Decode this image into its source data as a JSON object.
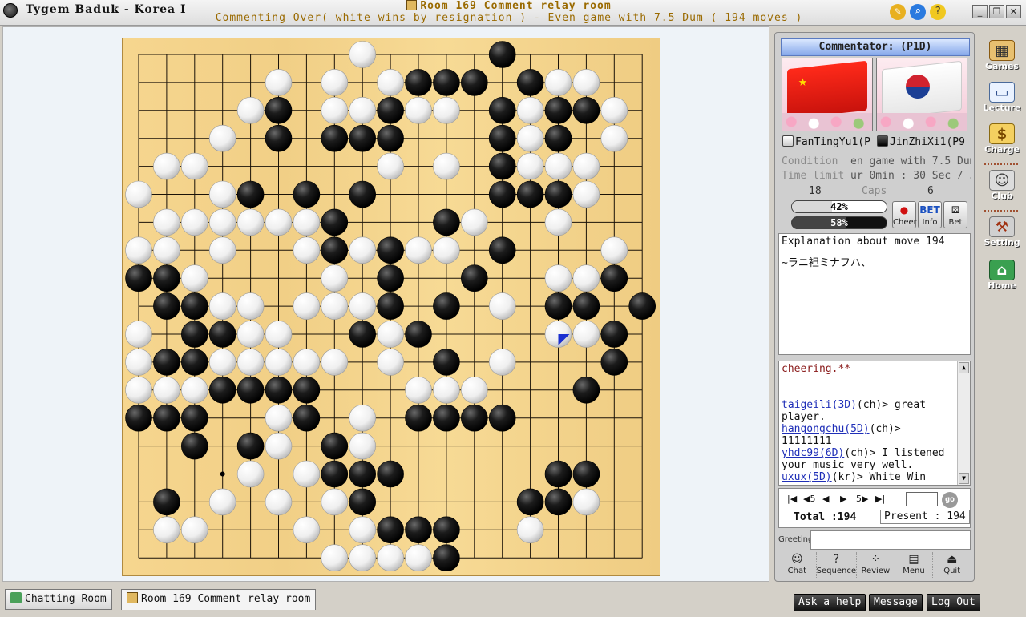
{
  "window": {
    "app_title": "Tygem Baduk - Korea I",
    "room_title": "Room 169 Comment relay room",
    "room_subtitle": "Commenting Over( white wins by resignation ) - Even game with 7.5 Dum  ( 194 moves )"
  },
  "board": {
    "size": 19,
    "black": [
      [
        13,
        0
      ],
      [
        10,
        1
      ],
      [
        11,
        1
      ],
      [
        12,
        1
      ],
      [
        14,
        1
      ],
      [
        5,
        2
      ],
      [
        9,
        2
      ],
      [
        13,
        2
      ],
      [
        15,
        2
      ],
      [
        16,
        2
      ],
      [
        5,
        3
      ],
      [
        7,
        3
      ],
      [
        8,
        3
      ],
      [
        9,
        3
      ],
      [
        13,
        3
      ],
      [
        15,
        3
      ],
      [
        13,
        4
      ],
      [
        4,
        5
      ],
      [
        6,
        5
      ],
      [
        8,
        5
      ],
      [
        13,
        5
      ],
      [
        14,
        5
      ],
      [
        15,
        5
      ],
      [
        7,
        6
      ],
      [
        11,
        6
      ],
      [
        7,
        7
      ],
      [
        9,
        7
      ],
      [
        13,
        7
      ],
      [
        0,
        8
      ],
      [
        1,
        8
      ],
      [
        9,
        8
      ],
      [
        12,
        8
      ],
      [
        17,
        8
      ],
      [
        1,
        9
      ],
      [
        2,
        9
      ],
      [
        9,
        9
      ],
      [
        11,
        9
      ],
      [
        15,
        9
      ],
      [
        16,
        9
      ],
      [
        18,
        9
      ],
      [
        2,
        10
      ],
      [
        3,
        10
      ],
      [
        8,
        10
      ],
      [
        10,
        10
      ],
      [
        17,
        10
      ],
      [
        1,
        11
      ],
      [
        2,
        11
      ],
      [
        11,
        11
      ],
      [
        17,
        11
      ],
      [
        3,
        12
      ],
      [
        4,
        12
      ],
      [
        5,
        12
      ],
      [
        6,
        12
      ],
      [
        16,
        12
      ],
      [
        0,
        13
      ],
      [
        1,
        13
      ],
      [
        2,
        13
      ],
      [
        6,
        13
      ],
      [
        10,
        13
      ],
      [
        11,
        13
      ],
      [
        12,
        13
      ],
      [
        13,
        13
      ],
      [
        2,
        14
      ],
      [
        4,
        14
      ],
      [
        7,
        14
      ],
      [
        7,
        15
      ],
      [
        8,
        15
      ],
      [
        9,
        15
      ],
      [
        15,
        15
      ],
      [
        16,
        15
      ],
      [
        1,
        16
      ],
      [
        8,
        16
      ],
      [
        14,
        16
      ],
      [
        15,
        16
      ],
      [
        9,
        17
      ],
      [
        10,
        17
      ],
      [
        11,
        17
      ],
      [
        11,
        18
      ]
    ],
    "white": [
      [
        8,
        0
      ],
      [
        5,
        1
      ],
      [
        7,
        1
      ],
      [
        9,
        1
      ],
      [
        15,
        1
      ],
      [
        16,
        1
      ],
      [
        4,
        2
      ],
      [
        7,
        2
      ],
      [
        8,
        2
      ],
      [
        10,
        2
      ],
      [
        11,
        2
      ],
      [
        14,
        2
      ],
      [
        17,
        2
      ],
      [
        3,
        3
      ],
      [
        14,
        3
      ],
      [
        17,
        3
      ],
      [
        1,
        4
      ],
      [
        2,
        4
      ],
      [
        9,
        4
      ],
      [
        11,
        4
      ],
      [
        14,
        4
      ],
      [
        15,
        4
      ],
      [
        16,
        4
      ],
      [
        0,
        5
      ],
      [
        3,
        5
      ],
      [
        16,
        5
      ],
      [
        1,
        6
      ],
      [
        2,
        6
      ],
      [
        3,
        6
      ],
      [
        4,
        6
      ],
      [
        5,
        6
      ],
      [
        6,
        6
      ],
      [
        12,
        6
      ],
      [
        15,
        6
      ],
      [
        0,
        7
      ],
      [
        1,
        7
      ],
      [
        3,
        7
      ],
      [
        6,
        7
      ],
      [
        8,
        7
      ],
      [
        10,
        7
      ],
      [
        11,
        7
      ],
      [
        17,
        7
      ],
      [
        2,
        8
      ],
      [
        7,
        8
      ],
      [
        15,
        8
      ],
      [
        16,
        8
      ],
      [
        3,
        9
      ],
      [
        4,
        9
      ],
      [
        6,
        9
      ],
      [
        7,
        9
      ],
      [
        8,
        9
      ],
      [
        13,
        9
      ],
      [
        0,
        10
      ],
      [
        4,
        10
      ],
      [
        5,
        10
      ],
      [
        9,
        10
      ],
      [
        15,
        10
      ],
      [
        16,
        10
      ],
      [
        0,
        11
      ],
      [
        3,
        11
      ],
      [
        4,
        11
      ],
      [
        5,
        11
      ],
      [
        6,
        11
      ],
      [
        7,
        11
      ],
      [
        9,
        11
      ],
      [
        13,
        11
      ],
      [
        0,
        12
      ],
      [
        1,
        12
      ],
      [
        2,
        12
      ],
      [
        10,
        12
      ],
      [
        11,
        12
      ],
      [
        12,
        12
      ],
      [
        5,
        13
      ],
      [
        8,
        13
      ],
      [
        5,
        14
      ],
      [
        8,
        14
      ],
      [
        4,
        15
      ],
      [
        6,
        15
      ],
      [
        3,
        16
      ],
      [
        5,
        16
      ],
      [
        7,
        16
      ],
      [
        16,
        16
      ],
      [
        1,
        17
      ],
      [
        2,
        17
      ],
      [
        6,
        17
      ],
      [
        8,
        17
      ],
      [
        14,
        17
      ],
      [
        7,
        18
      ],
      [
        8,
        18
      ],
      [
        9,
        18
      ],
      [
        10,
        18
      ]
    ],
    "last_move": [
      15,
      10
    ],
    "last_move_color": "#1a2fd0",
    "hoshi": [
      [
        3,
        3
      ],
      [
        9,
        3
      ],
      [
        15,
        3
      ],
      [
        3,
        9
      ],
      [
        9,
        9
      ],
      [
        15,
        9
      ],
      [
        3,
        15
      ],
      [
        9,
        15
      ],
      [
        15,
        15
      ]
    ]
  },
  "panel": {
    "commentator": "Commentator: (P1D)",
    "white_player": "FanTingYu1(P",
    "black_player": "JinZhiXi1(P9",
    "condition_label": "Condition",
    "condition_value": "en game with 7.5 Dum",
    "time_label": "Time limit",
    "time_value": "ur 0min : 30 Sec / 5",
    "white_caps": "18",
    "caps_label": "Caps",
    "black_caps": "6",
    "white_percent_text": "42%",
    "white_percent": 42,
    "black_percent_text": "58%",
    "black_percent": 58,
    "cheer_label": "Cheer",
    "info_label": "Info",
    "bet_label": "Bet",
    "explanation_title": "Explanation about move 194",
    "explanation_body": "~ラニ袒ミナフハ、"
  },
  "chat": {
    "system_line": "cheering.**",
    "messages": [
      {
        "nick": "taigeili(3D)",
        "region": "(ch)",
        "text": "> great player."
      },
      {
        "nick": "hangongchu(5D)",
        "region": "(ch)",
        "text": "> 11111111"
      },
      {
        "nick": "yhdc99(6D)",
        "region": "(ch)",
        "text": "> I listened your music very well."
      },
      {
        "nick": "uxux(5D)",
        "region": "(kr)",
        "text": "> White Win"
      }
    ]
  },
  "nav": {
    "first": "|◀",
    "back5": "◀5",
    "prev": "◀",
    "next": "▶",
    "fwd5": "5▶",
    "last": "▶|",
    "go_label": "go",
    "total_text": "Total :194",
    "present_text": "Present : 194"
  },
  "greeting_label": "Greeting",
  "tools": [
    "Chat",
    "Sequence",
    "Review",
    "Menu",
    "Quit"
  ],
  "sidebar": [
    "Games",
    "Lecture",
    "Charge",
    "Club",
    "Setting",
    "Home"
  ],
  "tabs": [
    "Chatting Room",
    "Room 169 Comment relay room"
  ],
  "bottom_buttons": [
    "Ask a help",
    "Message",
    "Log Out"
  ]
}
